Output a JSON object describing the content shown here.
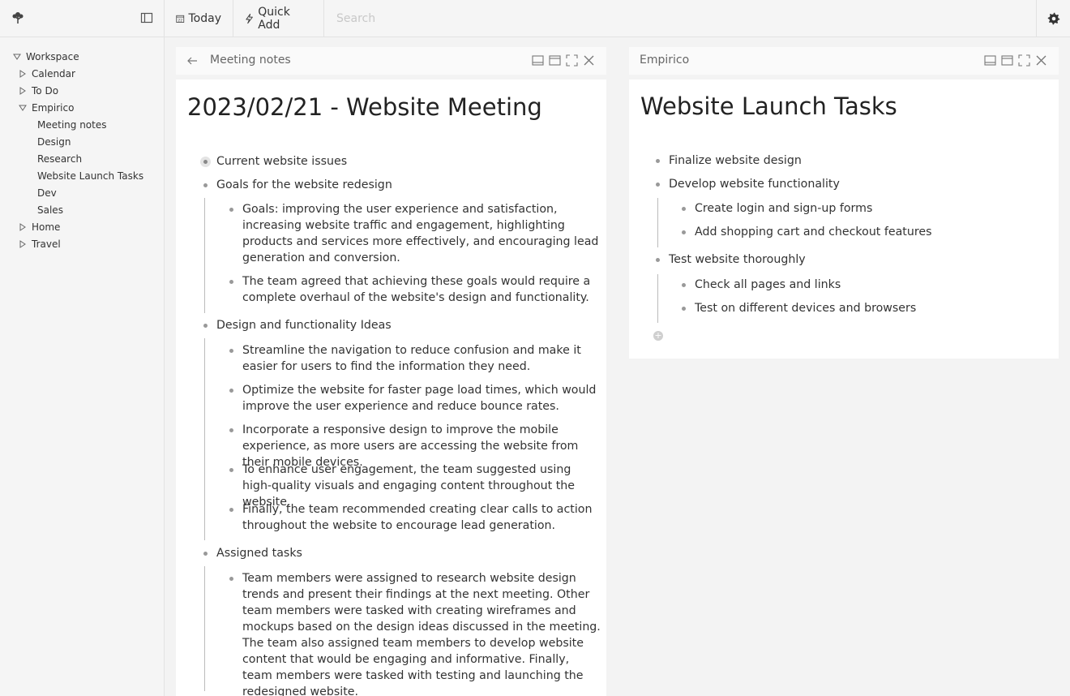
{
  "topbar": {
    "logo_icon": "tree-logo-icon",
    "sidebar_toggle_icon": "sidebar-toggle-icon",
    "today_label": "Today",
    "today_icon": "calendar-icon",
    "calendar_day": "22",
    "quick_add_label": "Quick Add",
    "quick_add_icon": "lightning-icon",
    "search_placeholder": "Search",
    "settings_icon": "gear-icon"
  },
  "sidebar": {
    "items": [
      {
        "label": "Workspace",
        "expander": "expanded"
      },
      {
        "label": "Calendar",
        "expander": "collapsed"
      },
      {
        "label": "To Do",
        "expander": "collapsed"
      },
      {
        "label": "Empirico",
        "expander": "expanded"
      },
      {
        "label": "Meeting notes",
        "expander": "none"
      },
      {
        "label": "Design",
        "expander": "none"
      },
      {
        "label": "Research",
        "expander": "none"
      },
      {
        "label": "Website Launch Tasks",
        "expander": "none"
      },
      {
        "label": "Dev",
        "expander": "none"
      },
      {
        "label": "Sales",
        "expander": "none"
      },
      {
        "label": "Home",
        "expander": "collapsed"
      },
      {
        "label": "Travel",
        "expander": "collapsed"
      }
    ]
  },
  "left_panel": {
    "breadcrumb": "Meeting notes",
    "title": "2023/02/21 - Website Meeting",
    "items": [
      {
        "text": "Current website issues"
      },
      {
        "text": "Goals for the website redesign",
        "children": [
          "Goals: improving the user experience and satisfaction, increasing website traffic and engagement, highlighting products and services more effectively, and encouraging lead generation and conversion.",
          "The team agreed that achieving these goals would require a complete overhaul of the website's design and functionality."
        ]
      },
      {
        "text": "Design and functionality Ideas",
        "children": [
          "Streamline the navigation to reduce confusion and make it easier for users to find the information they need.",
          "Optimize the website for faster page load times, which would improve the user experience and reduce bounce rates.",
          "Incorporate a responsive design to improve the mobile experience, as more users are accessing the website from their mobile devices.",
          "To enhance user engagement, the team suggested using high-quality visuals and engaging content throughout the website.",
          "Finally, the team recommended creating clear calls to action throughout the website to encourage lead generation."
        ]
      },
      {
        "text": "Assigned tasks",
        "children": [
          "Team members were assigned to research website design trends and present their findings at the next meeting. Other team members were tasked with creating wireframes and mockups based on the design ideas discussed in the meeting. The team also assigned team members to develop website content that would be engaging and informative. Finally, team members were tasked with testing and launching the redesigned website."
        ]
      }
    ]
  },
  "right_panel": {
    "breadcrumb": "Empirico",
    "title": "Website Launch Tasks",
    "items": [
      {
        "text": "Finalize website design"
      },
      {
        "text": "Develop website functionality",
        "children": [
          "Create login and sign-up forms",
          "Add shopping cart and checkout features"
        ]
      },
      {
        "text": "Test website thoroughly",
        "children": [
          "Check all pages and links",
          "Test on different devices and browsers"
        ]
      }
    ],
    "add_icon": "plus-icon"
  },
  "panel_icons": [
    "panel-bottom-icon",
    "panel-top-icon",
    "maximize-icon",
    "close-icon"
  ]
}
